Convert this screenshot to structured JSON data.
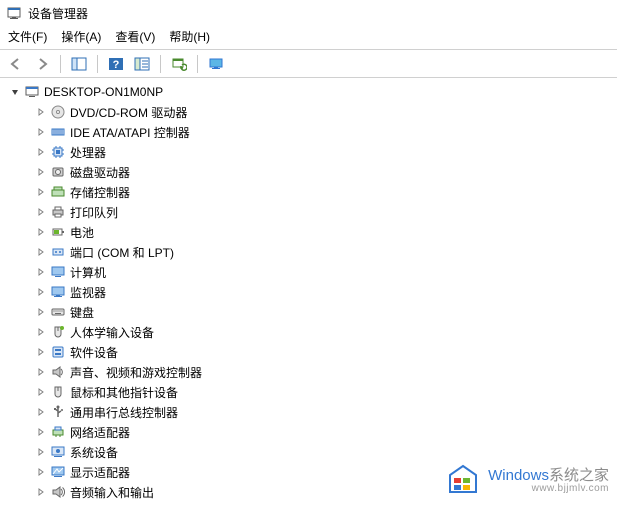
{
  "window": {
    "title": "设备管理器"
  },
  "menu": {
    "file": "文件(F)",
    "action": "操作(A)",
    "view": "查看(V)",
    "help": "帮助(H)"
  },
  "tree": {
    "root": {
      "label": "DESKTOP-ON1M0NP",
      "expanded": true
    },
    "categories": [
      {
        "label": "DVD/CD-ROM 驱动器",
        "icon": "disc"
      },
      {
        "label": "IDE ATA/ATAPI 控制器",
        "icon": "ide"
      },
      {
        "label": "处理器",
        "icon": "cpu"
      },
      {
        "label": "磁盘驱动器",
        "icon": "disk"
      },
      {
        "label": "存储控制器",
        "icon": "storage"
      },
      {
        "label": "打印队列",
        "icon": "printer"
      },
      {
        "label": "电池",
        "icon": "battery"
      },
      {
        "label": "端口 (COM 和 LPT)",
        "icon": "port"
      },
      {
        "label": "计算机",
        "icon": "computer"
      },
      {
        "label": "监视器",
        "icon": "monitor"
      },
      {
        "label": "键盘",
        "icon": "keyboard"
      },
      {
        "label": "人体学输入设备",
        "icon": "hid"
      },
      {
        "label": "软件设备",
        "icon": "software"
      },
      {
        "label": "声音、视频和游戏控制器",
        "icon": "sound"
      },
      {
        "label": "鼠标和其他指针设备",
        "icon": "mouse"
      },
      {
        "label": "通用串行总线控制器",
        "icon": "usb"
      },
      {
        "label": "网络适配器",
        "icon": "network"
      },
      {
        "label": "系统设备",
        "icon": "system"
      },
      {
        "label": "显示适配器",
        "icon": "display"
      },
      {
        "label": "音频输入和输出",
        "icon": "audio-io"
      }
    ]
  },
  "watermark": {
    "brand_en": "Windows",
    "brand_cn": "系统之家",
    "url": "www.bjjmlv.com"
  }
}
